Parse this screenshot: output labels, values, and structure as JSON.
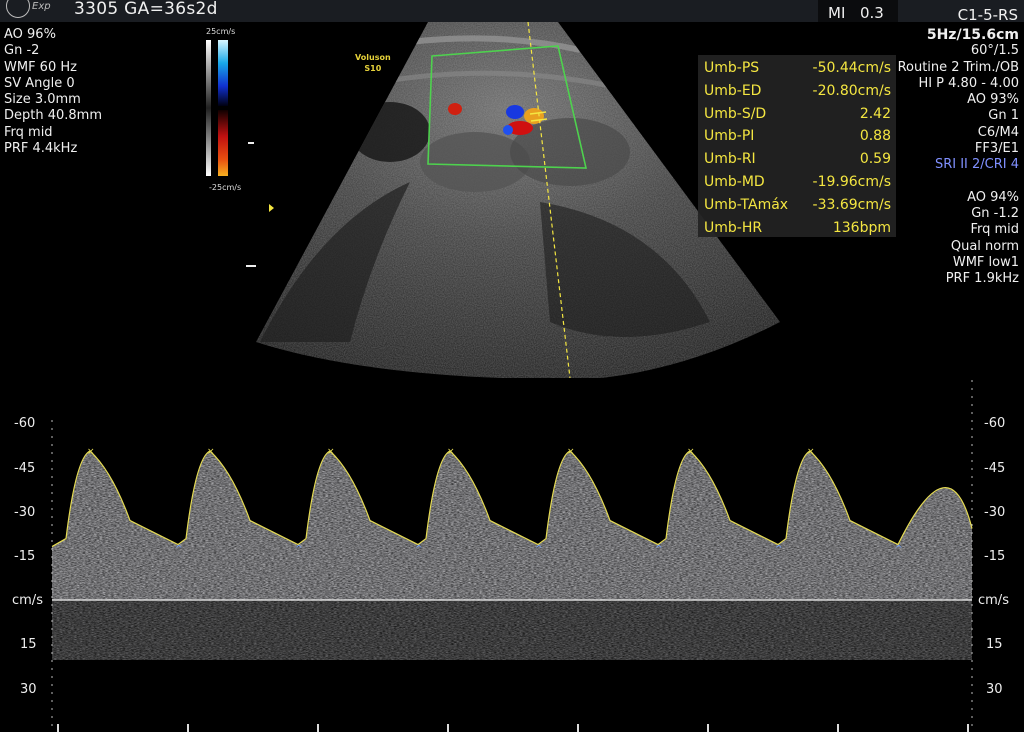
{
  "header": {
    "exp_label": "Exp",
    "patient_info": "3305   GA=36s2d",
    "mi_label": "MI",
    "mi_value": "0.3",
    "probe": "C1-5-RS"
  },
  "left_params": [
    "AO 96%",
    "Gn  -2",
    "WMF 60 Hz",
    "SV Angle  0",
    "Size  3.0mm",
    "Depth 40.8mm",
    "Frq mid",
    "PRF  4.4kHz"
  ],
  "right_params_top": [
    "5Hz/15.6cm",
    "60°/1.5",
    "Routine 2 Trim./OB",
    "HI P 4.80 - 4.00",
    "AO 93%",
    "Gn  1",
    "C6/M4",
    "FF3/E1"
  ],
  "right_params_sri": "SRI II 2/CRI 4",
  "right_params_bottom": [
    "AO 94%",
    "Gn -1.2",
    "Frq mid",
    "Qual norm",
    "WMF low1",
    "PRF  1.9kHz"
  ],
  "color_bar": {
    "top_label": "25cm/s",
    "bottom_label": "-25cm/s"
  },
  "brand": {
    "line1": "Voluson",
    "line2": "S10"
  },
  "measurements": [
    {
      "label": "Umb-PS",
      "value": "-50.44cm/s"
    },
    {
      "label": "Umb-ED",
      "value": "-20.80cm/s"
    },
    {
      "label": "Umb-S/D",
      "value": "2.42"
    },
    {
      "label": "Umb-PI",
      "value": "0.88"
    },
    {
      "label": "Umb-RI",
      "value": "0.59"
    },
    {
      "label": "Umb-MD",
      "value": "-19.96cm/s"
    },
    {
      "label": "Umb-TAmáx",
      "value": "-33.69cm/s"
    },
    {
      "label": "Umb-HR",
      "value": "136bpm"
    }
  ],
  "doppler_axis": {
    "unit": "cm/s",
    "ticks": [
      "-60",
      "-45",
      "-30",
      "-15",
      "15",
      "30"
    ],
    "tick_values": [
      -60,
      -45,
      -30,
      -15,
      15,
      30
    ]
  },
  "doppler_waveform": {
    "heart_rate_bpm": 136,
    "peak_systolic": -50.44,
    "end_diastolic": -20.8,
    "cycles": 7
  },
  "colors": {
    "caliper": "#f4e641",
    "trace": "#e6dc52",
    "roi": "#4ed24e",
    "sri_text": "#8090ff"
  }
}
